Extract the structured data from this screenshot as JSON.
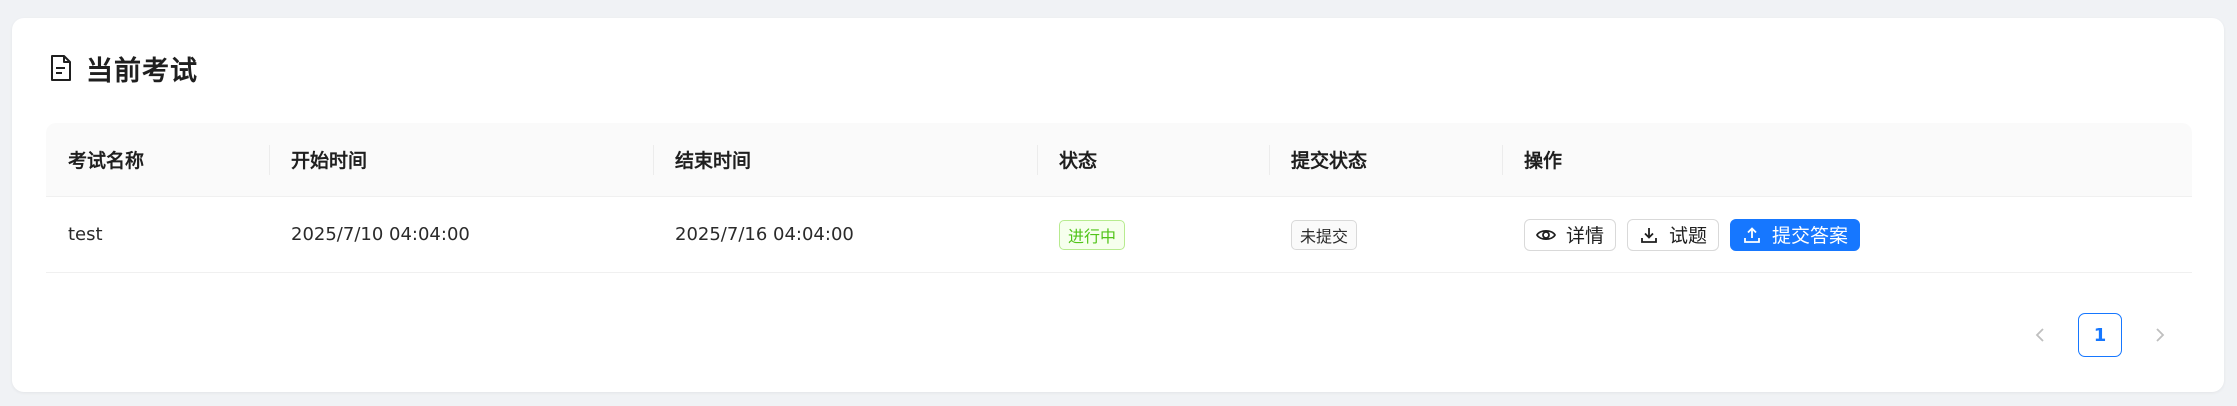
{
  "card": {
    "title": "当前考试",
    "title_icon": "document-icon"
  },
  "table": {
    "columns": [
      "考试名称",
      "开始时间",
      "结束时间",
      "状态",
      "提交状态",
      "操作"
    ],
    "rows": [
      {
        "name": "test",
        "start_time": "2025/7/10 04:04:00",
        "end_time": "2025/7/16 04:04:00",
        "status": "进行中",
        "submit_status": "未提交",
        "actions": {
          "details": "详情",
          "questions": "试题",
          "submit_answer": "提交答案"
        }
      }
    ]
  },
  "pagination": {
    "current_page": "1"
  },
  "colors": {
    "primary": "#1677ff",
    "status_green": "#52c41a",
    "background": "#f0f2f5"
  }
}
